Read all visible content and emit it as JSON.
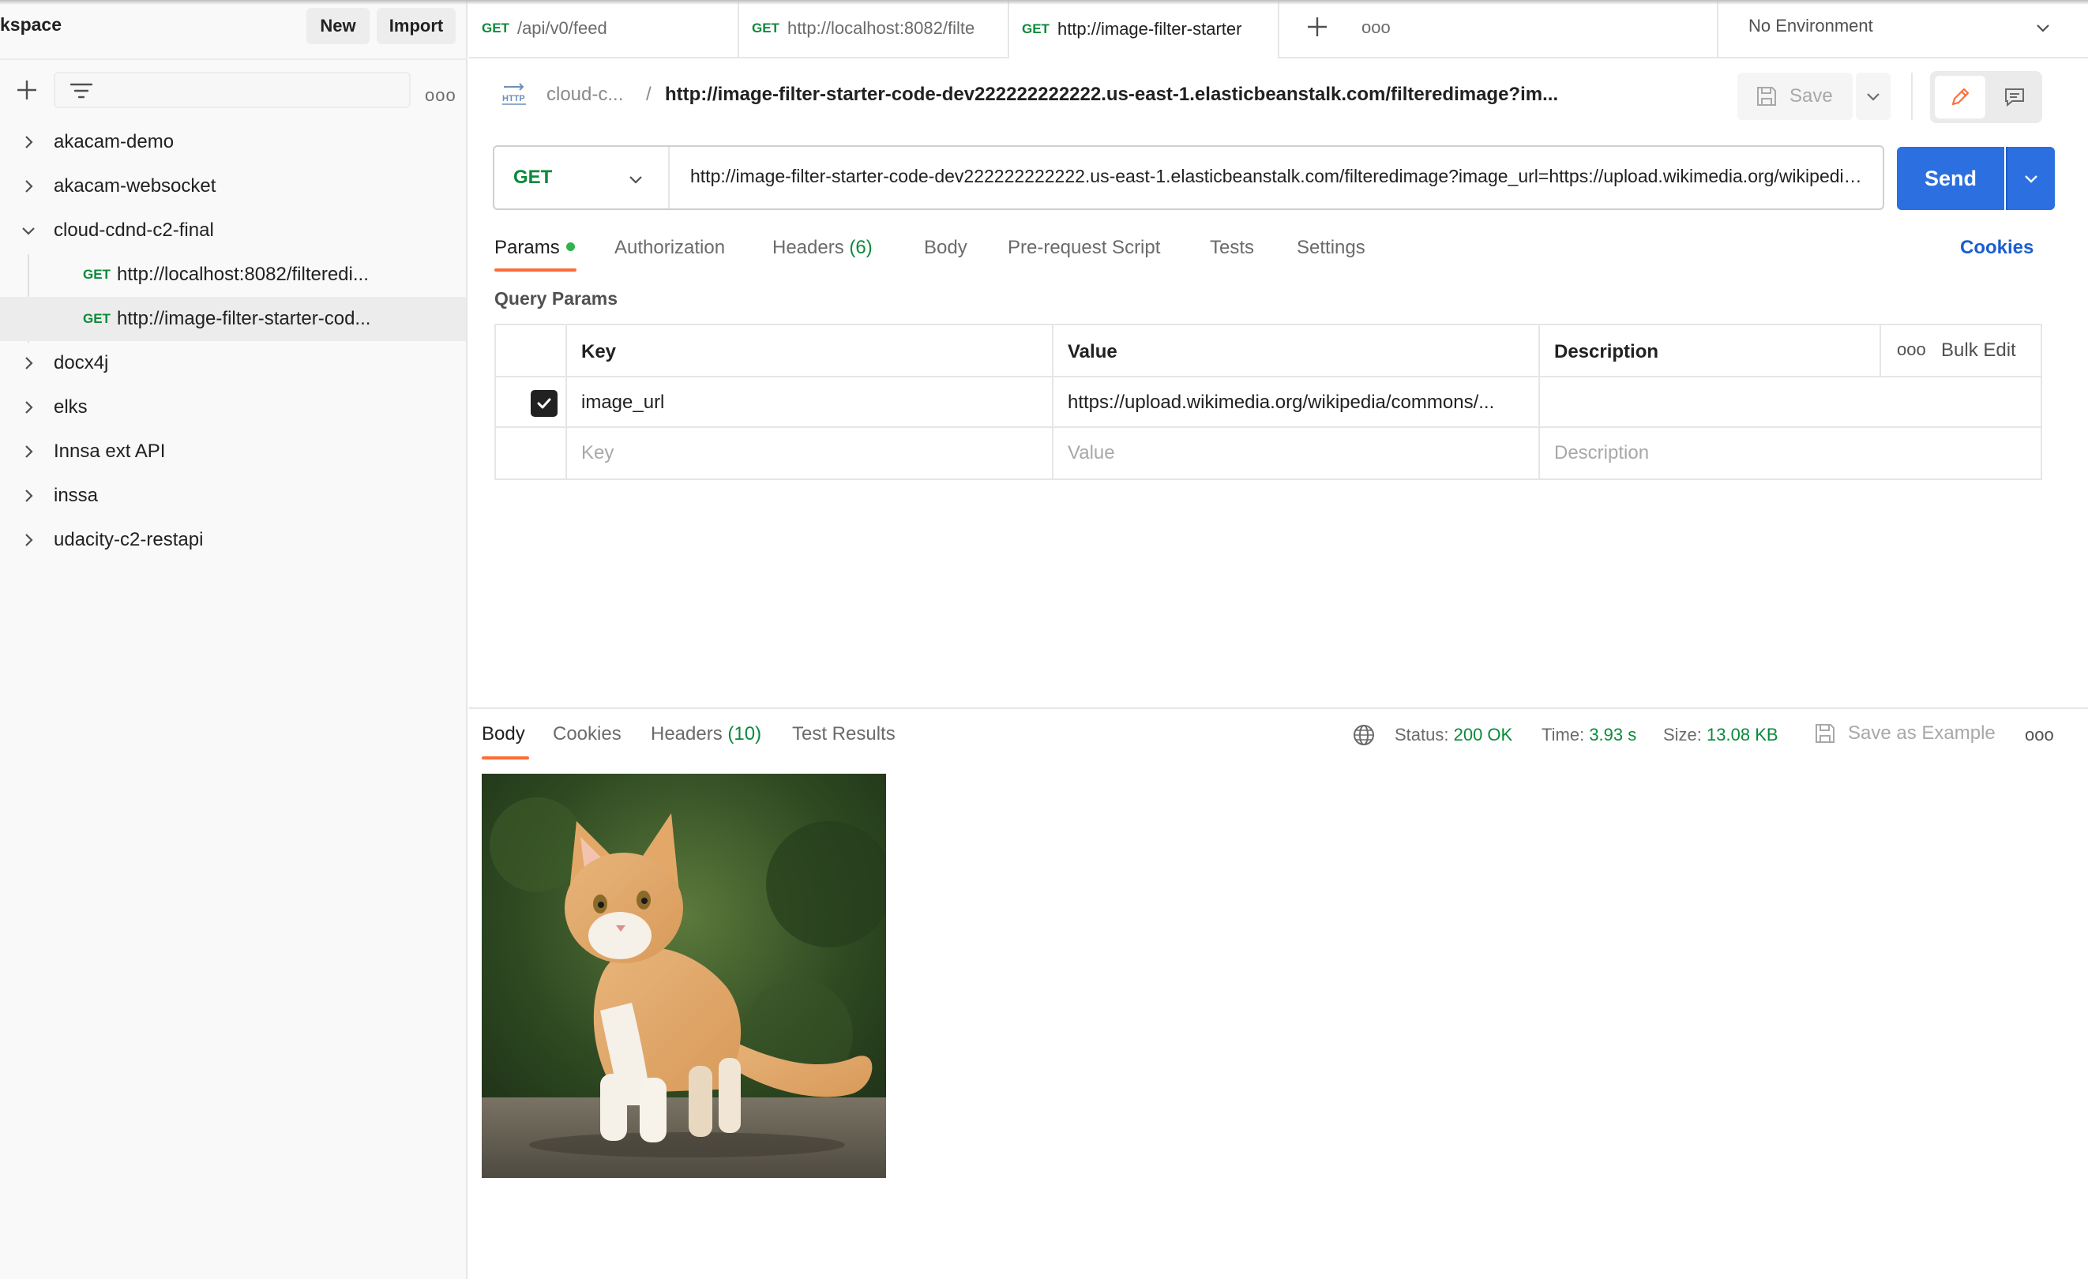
{
  "sidebar": {
    "workspace_title": "kspace",
    "new_label": "New",
    "import_label": "Import",
    "more_label": "ooo",
    "items": [
      {
        "label": "akacam-demo",
        "expanded": false
      },
      {
        "label": "akacam-websocket",
        "expanded": false
      },
      {
        "label": "cloud-cdnd-c2-final",
        "expanded": true
      },
      {
        "label": "docx4j",
        "expanded": false
      },
      {
        "label": "elks",
        "expanded": false
      },
      {
        "label": "Innsa ext API",
        "expanded": false
      },
      {
        "label": "inssa",
        "expanded": false
      },
      {
        "label": "udacity-c2-restapi",
        "expanded": false
      }
    ],
    "children": [
      {
        "method": "GET",
        "label": "http://localhost:8082/filteredi..."
      },
      {
        "method": "GET",
        "label": "http://image-filter-starter-cod..."
      }
    ]
  },
  "tabs": [
    {
      "method": "GET",
      "label": "/api/v0/feed"
    },
    {
      "method": "GET",
      "label": "http://localhost:8082/filte"
    },
    {
      "method": "GET",
      "label": "http://image-filter-starter"
    }
  ],
  "tabs_more": "ooo",
  "environment": "No Environment",
  "breadcrumb": {
    "parent": "cloud-c...",
    "separator": "/",
    "title": "http://image-filter-starter-code-dev222222222222.us-east-1.elasticbeanstalk.com/filteredimage?im..."
  },
  "save_label": "Save",
  "request": {
    "method": "GET",
    "url": "http://image-filter-starter-code-dev222222222222.us-east-1.elasticbeanstalk.com/filteredimage?image_url=https://upload.wikimedia.org/wikipedia/commons/...",
    "send_label": "Send"
  },
  "request_tabs": {
    "params": "Params",
    "authorization": "Authorization",
    "headers": "Headers",
    "headers_count": "(6)",
    "body": "Body",
    "prerequest": "Pre-request Script",
    "tests": "Tests",
    "settings": "Settings",
    "cookies": "Cookies"
  },
  "query_params": {
    "title": "Query Params",
    "headers": {
      "key": "Key",
      "value": "Value",
      "description": "Description"
    },
    "more_label": "ooo",
    "bulk_edit": "Bulk Edit",
    "rows": [
      {
        "checked": true,
        "key": "image_url",
        "value": "https://upload.wikimedia.org/wikipedia/commons/...",
        "description": ""
      }
    ],
    "placeholders": {
      "key": "Key",
      "value": "Value",
      "description": "Description"
    }
  },
  "response": {
    "tabs": {
      "body": "Body",
      "cookies": "Cookies",
      "headers": "Headers",
      "headers_count": "(10)",
      "test_results": "Test Results"
    },
    "status_label": "Status:",
    "status_value": "200 OK",
    "time_label": "Time:",
    "time_value": "3.93 s",
    "size_label": "Size:",
    "size_value": "13.08 KB",
    "save_example": "Save as Example",
    "more_label": "ooo"
  },
  "colors": {
    "accent_orange": "#ff6c37",
    "send_blue": "#2b6fe0",
    "method_green": "#0b8a3a",
    "status_green": "#0b8a3a",
    "link_blue": "#1b5dd1"
  },
  "icons": [
    "chevron-right-icon",
    "chevron-down-icon",
    "plus-icon",
    "filter-icon",
    "http-icon",
    "save-icon",
    "pencil-icon",
    "comment-icon",
    "globe-icon",
    "checkbox-checked-icon"
  ]
}
